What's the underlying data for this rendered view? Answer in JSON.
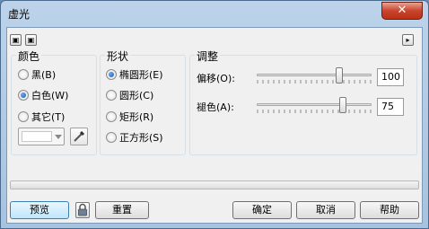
{
  "window": {
    "title": "虚光",
    "close_glyph": "✕"
  },
  "tiny_buttons": {
    "left1": "▣",
    "left2": "▣",
    "right": "▸"
  },
  "color_group": {
    "legend": "颜色",
    "options": [
      {
        "label": "黑(B)",
        "checked": false
      },
      {
        "label": "白色(W)",
        "checked": true
      },
      {
        "label": "其它(T)",
        "checked": false
      }
    ]
  },
  "shape_group": {
    "legend": "形状",
    "options": [
      {
        "label": "椭圆形(E)",
        "checked": true
      },
      {
        "label": "圆形(C)",
        "checked": false
      },
      {
        "label": "矩形(R)",
        "checked": false
      },
      {
        "label": "正方形(S)",
        "checked": false
      }
    ]
  },
  "adjust_group": {
    "legend": "调整",
    "offset": {
      "label": "偏移(O):",
      "value": "100"
    },
    "fade": {
      "label": "褪色(A):",
      "value": "75"
    }
  },
  "buttons": {
    "preview": "预览",
    "reset": "重置",
    "ok": "确定",
    "cancel": "取消",
    "help": "帮助"
  }
}
